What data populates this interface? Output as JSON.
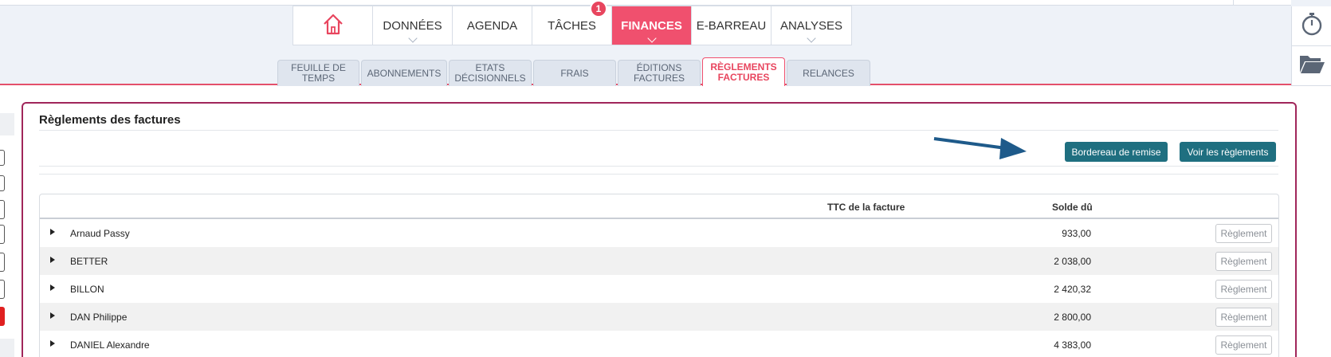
{
  "nav": {
    "items": [
      {
        "label": "",
        "icon": "home-icon",
        "width": 100
      },
      {
        "label": "DONNÉES",
        "chevron": true,
        "width": 100
      },
      {
        "label": "AGENDA",
        "chevron": false,
        "width": 100
      },
      {
        "label": "TÂCHES",
        "chevron": false,
        "width": 100
      },
      {
        "label": "FINANCES",
        "chevron": true,
        "active": true,
        "width": 100
      },
      {
        "label": "E-BARREAU",
        "chevron": false,
        "width": 100
      },
      {
        "label": "ANALYSES",
        "chevron": true,
        "width": 100
      }
    ],
    "taches_badge": "1"
  },
  "subnav": {
    "items": [
      "FEUILLE DE TEMPS",
      "ABONNEMENTS",
      "ETATS DÉCISIONNELS",
      "FRAIS",
      "ÉDITIONS FACTURES",
      "RÈGLEMENTS FACTURES",
      "RELANCES"
    ]
  },
  "panel": {
    "title": "Règlements des factures",
    "bordereau_label": "Bordereau de remise",
    "voir_label": "Voir les règlements"
  },
  "table": {
    "headers": {
      "ttc": "TTC de la facture",
      "solde": "Solde dû"
    },
    "rows": [
      {
        "name": "Arnaud Passy",
        "solde": "933,00",
        "action": "Règlement"
      },
      {
        "name": "BETTER",
        "solde": "2 038,00",
        "action": "Règlement"
      },
      {
        "name": "BILLON",
        "solde": "2 420,32",
        "action": "Règlement"
      },
      {
        "name": "DAN Philippe",
        "solde": "2 800,00",
        "action": "Règlement"
      },
      {
        "name": "DANIEL Alexandre",
        "solde": "4 383,00",
        "action": "Règlement"
      }
    ]
  },
  "colors": {
    "accent": "#f0506e",
    "button": "#1f6f80",
    "panel_border": "#a0265a",
    "arrow": "#1e5a8a"
  }
}
